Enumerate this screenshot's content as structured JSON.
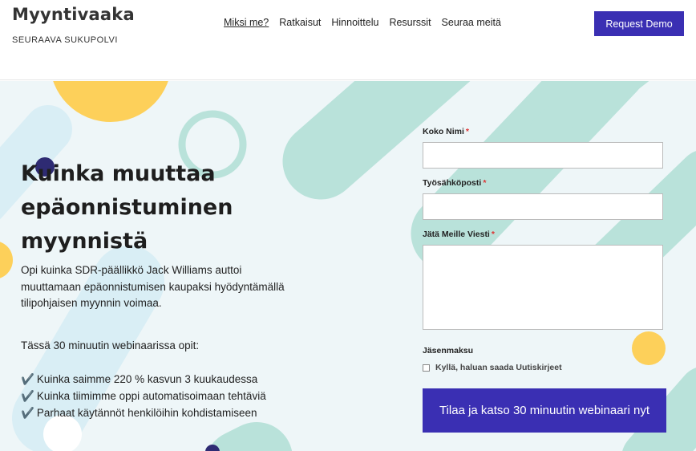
{
  "header": {
    "brand_title": "Myyntivaaka",
    "brand_tagline": "SEURAAVA SUKUPOLVI",
    "nav": [
      "Miksi me?",
      "Ratkaisut",
      "Hinnoittelu",
      "Resurssit",
      "Seuraa meitä"
    ],
    "demo_button": "Request Demo"
  },
  "hero": {
    "headline": "Kuinka muuttaa epäonnistuminen myynnistä",
    "intro": "Opi kuinka SDR-päällikkö Jack Williams auttoi muuttamaan epäonnistumisen kaupaksi hyödyntämällä tilipohjaisen myynnin voimaa.",
    "lead": "Tässä 30 minuutin webinaarissa opit:",
    "bullets": [
      "Kuinka saimme 220 % kasvun 3 kuukaudessa",
      "Kuinka tiimimme oppi automatisoimaan tehtäviä",
      "Parhaat käytännöt henkilöihin kohdistamiseen"
    ],
    "check_glyph": "✔️"
  },
  "form": {
    "name_label": "Koko Nimi",
    "email_label": "Työsähköposti",
    "message_label": "Jätä Meille Viesti",
    "required_mark": "*",
    "membership_label": "Jäsenmaksu",
    "newsletter_label": "Kyllä, haluan saada Uutiskirjeet",
    "submit_label": "Tilaa ja katso 30 minuutin webinaari nyt"
  },
  "colors": {
    "accent": "#3a2fb3",
    "mint": "#b9e2da",
    "yellow": "#fdd05a",
    "navy": "#2e2b73",
    "background": "#eef6f8"
  }
}
